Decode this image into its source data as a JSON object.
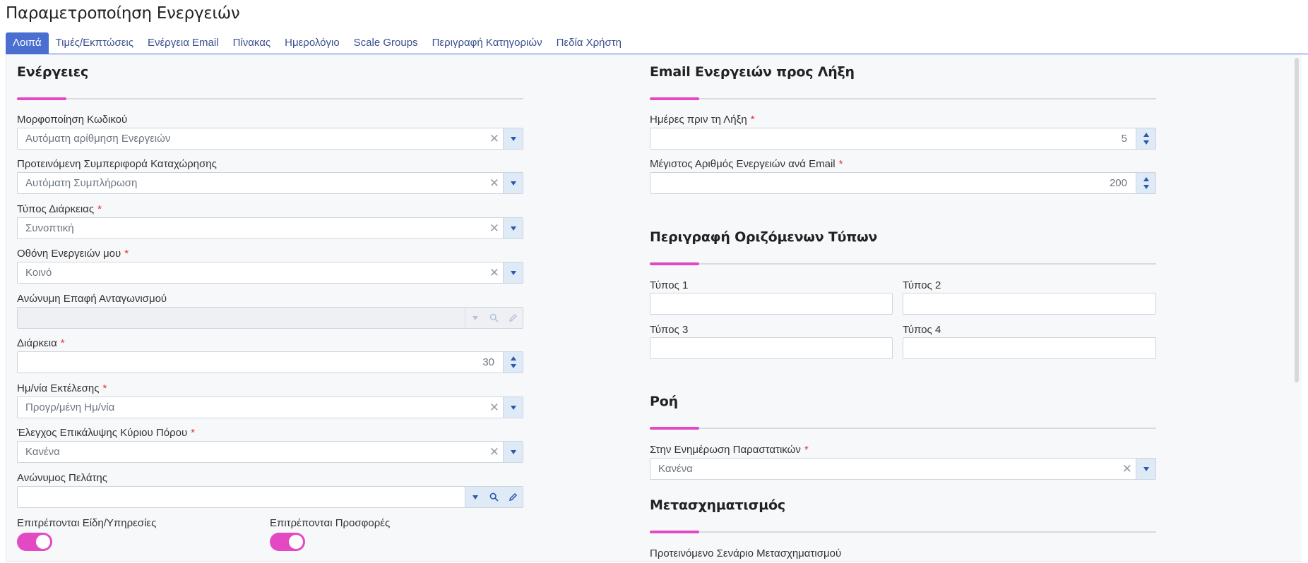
{
  "page": {
    "title": "Παραμετροποίηση Ενεργειών"
  },
  "tabs": [
    {
      "label": "Λοιπά",
      "active": true
    },
    {
      "label": "Τιμές/Εκπτώσεις"
    },
    {
      "label": "Ενέργεια Email"
    },
    {
      "label": "Πίνακας"
    },
    {
      "label": "Ημερολόγιο"
    },
    {
      "label": "Scale Groups"
    },
    {
      "label": "Περιγραφή Κατηγοριών"
    },
    {
      "label": "Πεδία Χρήστη"
    }
  ],
  "left": {
    "section_title": "Ενέργειες",
    "code_format": {
      "label": "Μορφοποίηση Κωδικού",
      "value": "Αυτόματη αρίθμηση Ενεργειών"
    },
    "entry_behavior": {
      "label": "Προτεινόμενη Συμπεριφορά Καταχώρησης",
      "value": "Αυτόματη Συμπλήρωση"
    },
    "duration_type": {
      "label": "Τύπος Διάρκειας",
      "value": "Συνοπτική"
    },
    "my_actions_screen": {
      "label": "Οθόνη Ενεργειών μου",
      "value": "Κοινό"
    },
    "anon_competitor": {
      "label": "Ανώνυμη Επαφή Ανταγωνισμού",
      "value": ""
    },
    "duration": {
      "label": "Διάρκεια",
      "value": "30"
    },
    "exec_date": {
      "label": "Ημ/νία Εκτέλεσης",
      "value": "Προγρ/μένη Ημ/νία"
    },
    "resource_overlap": {
      "label": "Έλεγχος Επικάλυψης Κύριου Πόρου",
      "value": "Κανένα"
    },
    "anon_customer": {
      "label": "Ανώνυμος Πελάτης",
      "value": ""
    },
    "allow_items": {
      "label": "Επιτρέπονται Είδη/Υπηρεσίες",
      "on": true
    },
    "allow_offers": {
      "label": "Επιτρέπονται Προσφορές",
      "on": true
    },
    "required_mark": "*",
    "clear_glyph": "✕"
  },
  "right": {
    "email_section": {
      "title": "Email Ενεργειών προς Λήξη",
      "days_before": {
        "label": "Ημέρες πριν τη Λήξη",
        "value": "5"
      },
      "max_per_email": {
        "label": "Μέγιστος Αριθμός Ενεργειών ανά Email",
        "value": "200"
      }
    },
    "types_section": {
      "title": "Περιγραφή Οριζόμενων Τύπων",
      "type1": {
        "label": "Τύπος 1",
        "value": ""
      },
      "type2": {
        "label": "Τύπος 2",
        "value": ""
      },
      "type3": {
        "label": "Τύπος 3",
        "value": ""
      },
      "type4": {
        "label": "Τύπος 4",
        "value": ""
      }
    },
    "flow_section": {
      "title": "Ροή",
      "on_update": {
        "label": "Στην Ενημέρωση Παραστατικών",
        "value": "Κανένα"
      }
    },
    "transform_section": {
      "title": "Μετασχηματισμός",
      "scenario_label": "Προτεινόμενο Σενάριο Μετασχηματισμού"
    }
  },
  "colors": {
    "accent": "#e349c3",
    "tab_active": "#4a6fd1",
    "dropdown_bg": "#dfeaf7"
  }
}
